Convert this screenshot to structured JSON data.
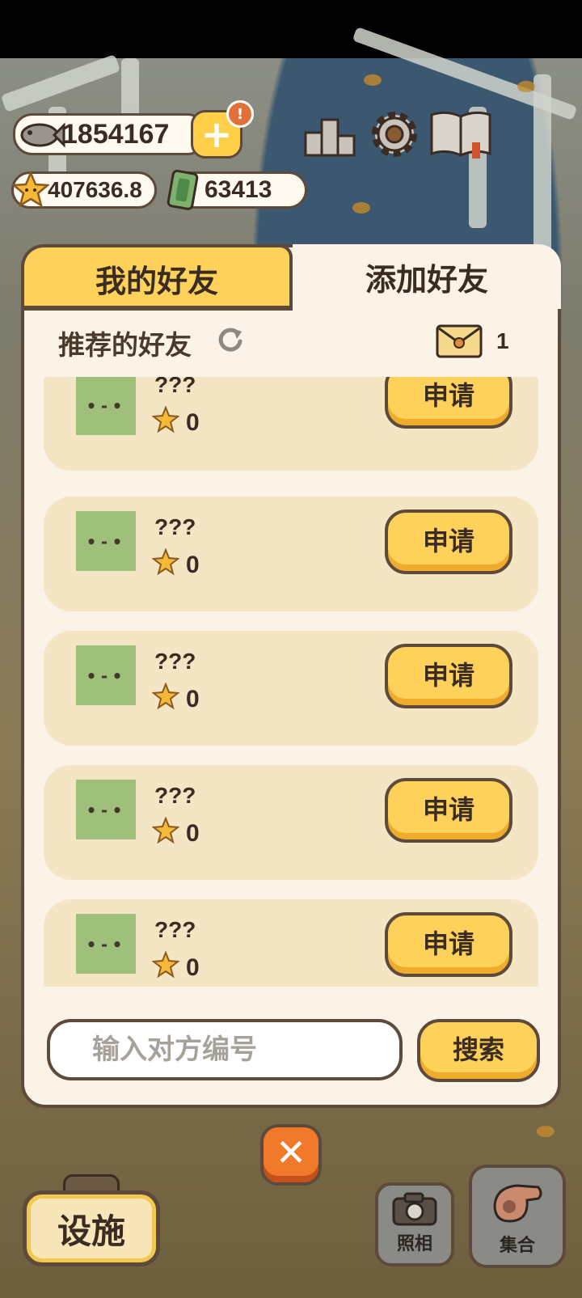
{
  "header": {
    "fish": "1854167",
    "stars": "407636.8",
    "tickets": "63413",
    "add_label": "+",
    "alert_label": "!"
  },
  "icons": [
    "fish-icon",
    "plus-icon",
    "star-icon",
    "ticket-icon",
    "ranking-icon",
    "gear-icon",
    "book-icon",
    "refresh-icon",
    "mail-icon",
    "camera-icon",
    "whistle-icon",
    "close-icon"
  ],
  "tabs": {
    "my_friends": "我的好友",
    "add_friends": "添加好友"
  },
  "recommend": {
    "title": "推荐的好友",
    "mail_count": "1"
  },
  "friends": [
    {
      "name": "???",
      "score": "0",
      "face": "•-•",
      "button": "申请"
    },
    {
      "name": "???",
      "score": "0",
      "face": "•-•",
      "button": "申请"
    },
    {
      "name": "???",
      "score": "0",
      "face": "•-•",
      "button": "申请"
    },
    {
      "name": "???",
      "score": "0",
      "face": "•-•",
      "button": "申请"
    },
    {
      "name": "???",
      "score": "0",
      "face": "•-•",
      "button": "申请"
    }
  ],
  "search": {
    "placeholder": "输入对方编号",
    "button": "搜索"
  },
  "close_label": "✕",
  "bottom": {
    "facility": "设施",
    "photo": "照相",
    "gather": "集合"
  },
  "colors": {
    "accent": "#fdd15a",
    "panel": "#fbf3e8",
    "card": "#f4e5c4",
    "outline": "#5e4a3a",
    "close": "#f07a2a",
    "avatar": "#9ec07b"
  }
}
